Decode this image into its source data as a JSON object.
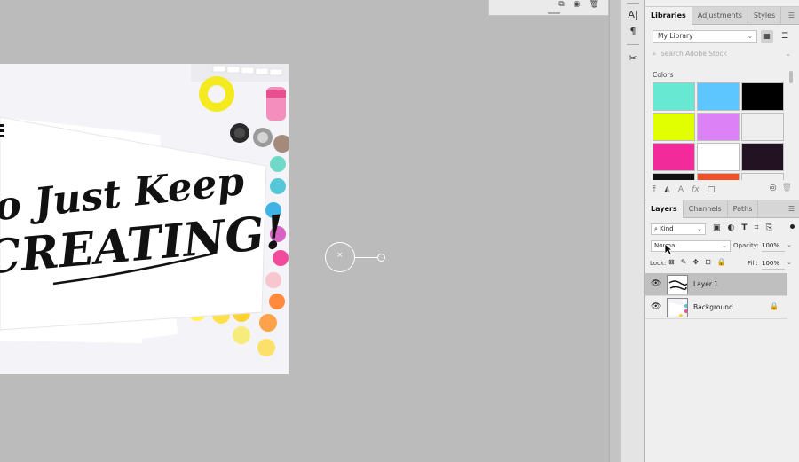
{
  "canvas": {
    "artwork_text_line1": "o Just Keep",
    "artwork_text_line2": "CREATING!",
    "brush_cursor_mark": "×"
  },
  "float_panel": {
    "icons": [
      "layer-comp-icon",
      "camera-icon",
      "trash-icon"
    ]
  },
  "tool_strip": {
    "items": [
      {
        "glyph": "A|",
        "icon": "character-icon"
      },
      {
        "glyph": "¶",
        "icon": "paragraph-icon"
      },
      {
        "glyph": "✂",
        "icon": "tool-presets-icon"
      }
    ]
  },
  "libraries": {
    "tabs": [
      "Libraries",
      "Adjustments",
      "Styles"
    ],
    "active_tab": "Libraries",
    "library_name": "My Library",
    "search_placeholder": "Search Adobe Stock",
    "colors_label": "Colors",
    "swatches": [
      "#66e8d2",
      "#5ec6ff",
      "#000000",
      "#e1ff00",
      "#dc82f6",
      "#eeeeee",
      "#f22b9a",
      "#ffffff",
      "#231221",
      "#111111",
      "#f24e27",
      "#efefef"
    ]
  },
  "layers": {
    "tabs": [
      "Layers",
      "Channels",
      "Paths"
    ],
    "active_tab": "Layers",
    "kind_label": "Kind",
    "blend_mode": "Normal",
    "opacity_label": "Opacity:",
    "opacity_value": "100%",
    "lock_label": "Lock:",
    "fill_label": "Fill:",
    "fill_value": "100%",
    "items": [
      {
        "name": "Layer 1",
        "selected": true,
        "locked": false
      },
      {
        "name": "Background",
        "selected": false,
        "locked": true
      }
    ]
  }
}
